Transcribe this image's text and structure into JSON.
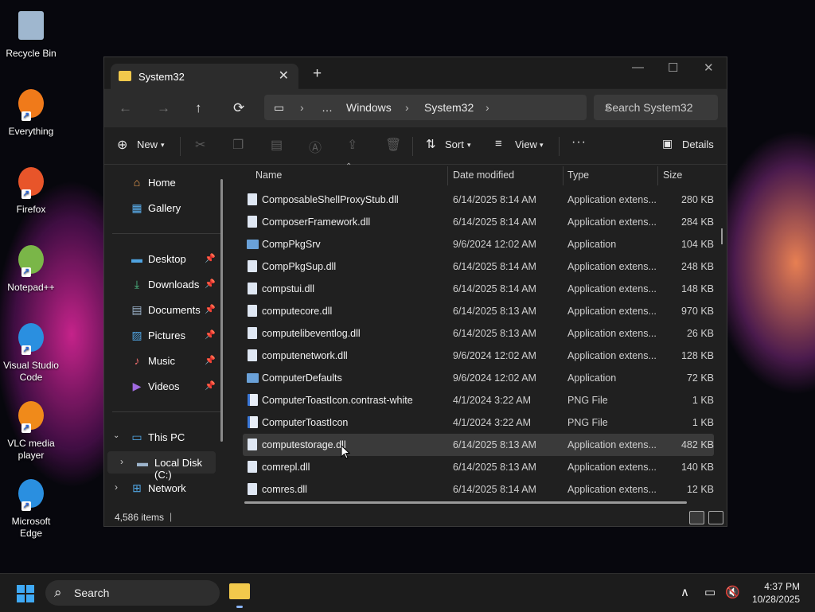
{
  "desktop": {
    "icons": [
      {
        "label": "Recycle Bin",
        "icon": "recycle-bin-icon"
      },
      {
        "label": "Everything",
        "icon": "everything-search-icon"
      },
      {
        "label": "Firefox",
        "icon": "firefox-icon"
      },
      {
        "label": "Notepad++",
        "icon": "notepad-plus-plus-icon"
      },
      {
        "label": "Visual Studio Code",
        "icon": "vscode-icon"
      },
      {
        "label": "VLC media player",
        "icon": "vlc-icon"
      },
      {
        "label": "Microsoft Edge",
        "icon": "edge-icon"
      }
    ]
  },
  "window": {
    "tab_title": "System32",
    "new_tab_label": "+",
    "breadcrumb": [
      "…",
      "Windows",
      "System32"
    ],
    "search_placeholder": "Search System32",
    "toolbar": {
      "new_label": "New",
      "sort_label": "Sort",
      "view_label": "View",
      "more_label": "···",
      "details_label": "Details"
    }
  },
  "sidebar": {
    "top": [
      {
        "label": "Home",
        "icon": "home-icon"
      },
      {
        "label": "Gallery",
        "icon": "gallery-icon"
      }
    ],
    "quick": [
      {
        "label": "Desktop",
        "icon": "desktop-folder-icon"
      },
      {
        "label": "Downloads",
        "icon": "downloads-folder-icon"
      },
      {
        "label": "Documents",
        "icon": "documents-folder-icon"
      },
      {
        "label": "Pictures",
        "icon": "pictures-folder-icon"
      },
      {
        "label": "Music",
        "icon": "music-folder-icon"
      },
      {
        "label": "Videos",
        "icon": "videos-folder-icon"
      }
    ],
    "this_pc": "This PC",
    "local_disk": "Local Disk (C:)",
    "network": "Network"
  },
  "columns": {
    "name": "Name",
    "date": "Date modified",
    "type": "Type",
    "size": "Size"
  },
  "files": [
    {
      "name": "ComposableShellProxyStub.dll",
      "date": "6/14/2025 8:14 AM",
      "type": "Application extens...",
      "size": "280 KB",
      "kind": "dll"
    },
    {
      "name": "ComposerFramework.dll",
      "date": "6/14/2025 8:14 AM",
      "type": "Application extens...",
      "size": "284 KB",
      "kind": "dll"
    },
    {
      "name": "CompPkgSrv",
      "date": "9/6/2024 12:02 AM",
      "type": "Application",
      "size": "104 KB",
      "kind": "app"
    },
    {
      "name": "CompPkgSup.dll",
      "date": "6/14/2025 8:14 AM",
      "type": "Application extens...",
      "size": "248 KB",
      "kind": "dll"
    },
    {
      "name": "compstui.dll",
      "date": "6/14/2025 8:14 AM",
      "type": "Application extens...",
      "size": "148 KB",
      "kind": "dll"
    },
    {
      "name": "computecore.dll",
      "date": "6/14/2025 8:13 AM",
      "type": "Application extens...",
      "size": "970 KB",
      "kind": "dll"
    },
    {
      "name": "computelibeventlog.dll",
      "date": "6/14/2025 8:13 AM",
      "type": "Application extens...",
      "size": "26 KB",
      "kind": "dll"
    },
    {
      "name": "computenetwork.dll",
      "date": "9/6/2024 12:02 AM",
      "type": "Application extens...",
      "size": "128 KB",
      "kind": "dll"
    },
    {
      "name": "ComputerDefaults",
      "date": "9/6/2024 12:02 AM",
      "type": "Application",
      "size": "72 KB",
      "kind": "app"
    },
    {
      "name": "ComputerToastIcon.contrast-white",
      "date": "4/1/2024 3:22 AM",
      "type": "PNG File",
      "size": "1 KB",
      "kind": "png"
    },
    {
      "name": "ComputerToastIcon",
      "date": "4/1/2024 3:22 AM",
      "type": "PNG File",
      "size": "1 KB",
      "kind": "png"
    },
    {
      "name": "computestorage.dll",
      "date": "6/14/2025 8:13 AM",
      "type": "Application extens...",
      "size": "482 KB",
      "kind": "dll",
      "selected": true
    },
    {
      "name": "comrepl.dll",
      "date": "6/14/2025 8:13 AM",
      "type": "Application extens...",
      "size": "140 KB",
      "kind": "dll"
    },
    {
      "name": "comres.dll",
      "date": "6/14/2025 8:14 AM",
      "type": "Application extens...",
      "size": "12 KB",
      "kind": "dll"
    }
  ],
  "status": {
    "item_count": "4,586 items"
  },
  "taskbar": {
    "search_label": "Search",
    "time": "4:37 PM",
    "date": "10/28/2025"
  }
}
